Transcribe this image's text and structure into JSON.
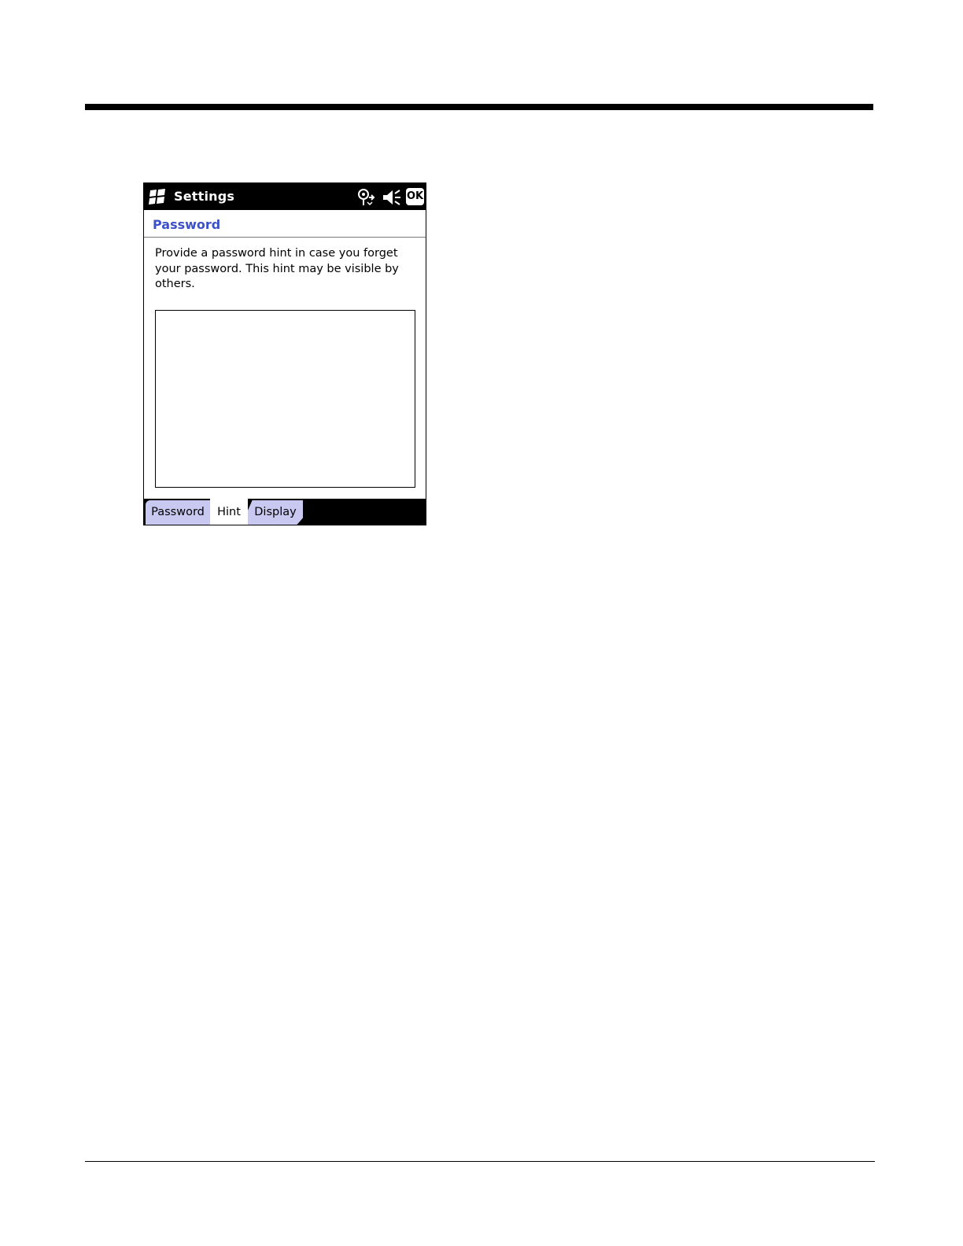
{
  "window": {
    "title": "Settings",
    "ok_label": "OK"
  },
  "page": {
    "title": "Password",
    "instructions": "Provide a password hint in case you forget\nyour password.  This hint may be visible by\nothers."
  },
  "hint_input": {
    "value": ""
  },
  "tabs": [
    {
      "label": "Password",
      "selected": false
    },
    {
      "label": "Hint",
      "selected": true
    },
    {
      "label": "Display",
      "selected": false
    }
  ],
  "icons": {
    "start": "windows-start-icon",
    "connectivity": "connectivity-icon",
    "volume": "speaker-volume-icon"
  },
  "colors": {
    "title_accent": "#3c50c8",
    "tab_inactive": "#c8c8f0",
    "bar": "#000000"
  }
}
